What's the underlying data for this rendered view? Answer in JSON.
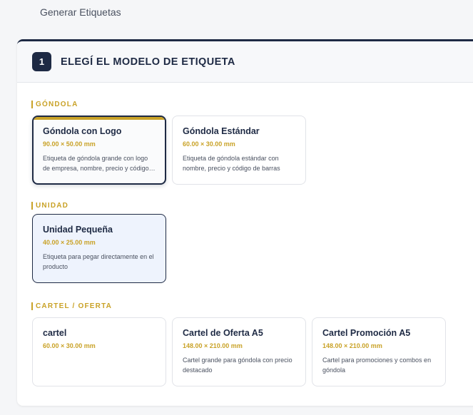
{
  "page": {
    "title": "Generar Etiquetas"
  },
  "step": {
    "number": "1",
    "title": "ELEGÍ EL MODELO DE ETIQUETA"
  },
  "groups": [
    {
      "label": "GÓNDOLA",
      "cards": [
        {
          "name": "Góndola con Logo",
          "size": "90.00 × 50.00 mm",
          "desc": "Etiqueta de góndola grande con logo de empresa, nombre, precio y código de barras"
        },
        {
          "name": "Góndola Estándar",
          "size": "60.00 × 30.00 mm",
          "desc": "Etiqueta de góndola estándar con nombre, precio y código de barras"
        }
      ]
    },
    {
      "label": "UNIDAD",
      "cards": [
        {
          "name": "Unidad Pequeña",
          "size": "40.00 × 25.00 mm",
          "desc": "Etiqueta para pegar directamente en el producto"
        }
      ]
    },
    {
      "label": "CARTEL / OFERTA",
      "cards": [
        {
          "name": "cartel",
          "size": "60.00 × 30.00 mm",
          "desc": ""
        },
        {
          "name": "Cartel de Oferta A5",
          "size": "148.00 × 210.00 mm",
          "desc": "Cartel grande para góndola con precio destacado"
        },
        {
          "name": "Cartel Promoción A5",
          "size": "148.00 × 210.00 mm",
          "desc": "Cartel para promociones y combos en góndola"
        }
      ]
    }
  ]
}
